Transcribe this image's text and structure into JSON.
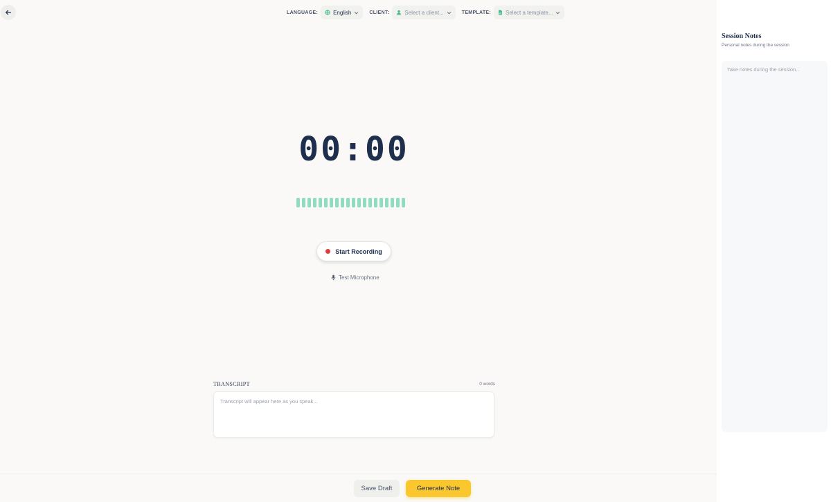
{
  "header": {
    "language_label": "LANGUAGE:",
    "language_value": "English",
    "client_label": "CLIENT:",
    "client_placeholder": "Select a client...",
    "template_label": "TEMPLATE:",
    "template_placeholder": "Select a template..."
  },
  "recorder": {
    "timer": "00:00",
    "wave_bar_count": 20,
    "start_label": "Start Recording",
    "test_mic_label": "Test Microphone"
  },
  "transcript": {
    "label": "TRANSCRIPT",
    "word_count": "0 words",
    "placeholder": "Transcript will appear here as you speak..."
  },
  "footer": {
    "save_draft": "Save Draft",
    "generate_note": "Generate Note"
  },
  "sidebar": {
    "title": "Session Notes",
    "subtitle": "Personal notes during the session",
    "notes_placeholder": "Take notes during the session..."
  },
  "colors": {
    "accent_yellow": "#fbc72f",
    "wave_green": "#8fdcc0",
    "record_red": "#e23b3b",
    "navy": "#1e2f4d"
  },
  "icons": {
    "back": "arrow-left-icon",
    "language": "globe-icon",
    "client": "user-icon",
    "template": "document-icon",
    "chevron": "chevron-down-icon",
    "mic": "microphone-icon"
  }
}
